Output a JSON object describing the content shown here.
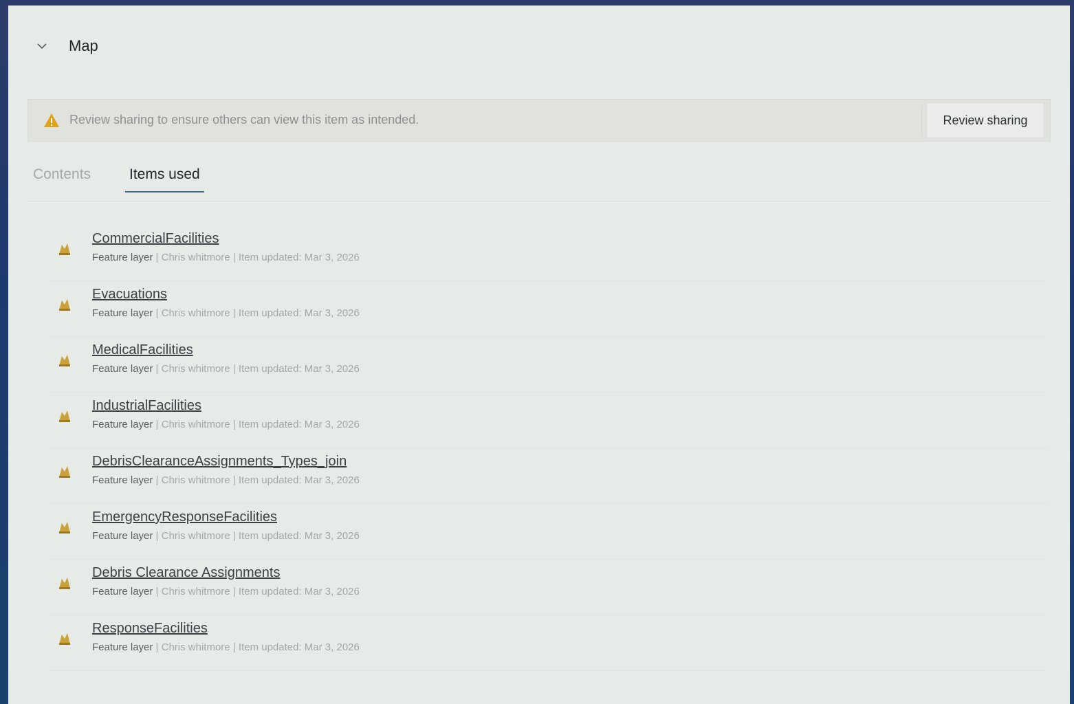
{
  "header": {
    "title": "Map",
    "chevron_icon": "chevron-down-icon"
  },
  "alert": {
    "icon": "warning-icon",
    "icon_color": "#e0a21e",
    "message": "Review sharing to ensure others can view this item as intended.",
    "button_label": "Review sharing"
  },
  "tabs": [
    {
      "label": "Contents",
      "active": false
    },
    {
      "label": "Items used",
      "active": true
    }
  ],
  "items": [
    {
      "name": "CommercialFacilities",
      "type": "Feature layer",
      "owner": "Chris whitmore",
      "updated": "Item updated: Mar 3, 2026",
      "icon": "feature-layer-icon"
    },
    {
      "name": "Evacuations",
      "type": "Feature layer",
      "owner": "Chris whitmore",
      "updated": "Item updated: Mar 3, 2026",
      "icon": "feature-layer-icon"
    },
    {
      "name": "MedicalFacilities",
      "type": "Feature layer",
      "owner": "Chris whitmore",
      "updated": "Item updated: Mar 3, 2026",
      "icon": "feature-layer-icon"
    },
    {
      "name": "IndustrialFacilities",
      "type": "Feature layer",
      "owner": "Chris whitmore",
      "updated": "Item updated: Mar 3, 2026",
      "icon": "feature-layer-icon"
    },
    {
      "name": "DebrisClearanceAssignments_Types_join",
      "type": "Feature layer",
      "owner": "Chris whitmore",
      "updated": "Item updated: Mar 3, 2026",
      "icon": "feature-layer-icon"
    },
    {
      "name": "EmergencyResponseFacilities",
      "type": "Feature layer",
      "owner": "Chris whitmore",
      "updated": "Item updated: Mar 3, 2026",
      "icon": "feature-layer-icon"
    },
    {
      "name": "Debris Clearance Assignments",
      "type": "Feature layer",
      "owner": "Chris whitmore",
      "updated": "Item updated: Mar 3, 2026",
      "icon": "feature-layer-icon"
    },
    {
      "name": "ResponseFacilities",
      "type": "Feature layer",
      "owner": "Chris whitmore",
      "updated": "Item updated: Mar 3, 2026",
      "icon": "feature-layer-icon"
    }
  ],
  "meta_separator": "|",
  "colors": {
    "panel_background": "#e6ebe7",
    "active_tab_underline": "#3a6a8e",
    "layer_icon": "#c9a23c"
  }
}
